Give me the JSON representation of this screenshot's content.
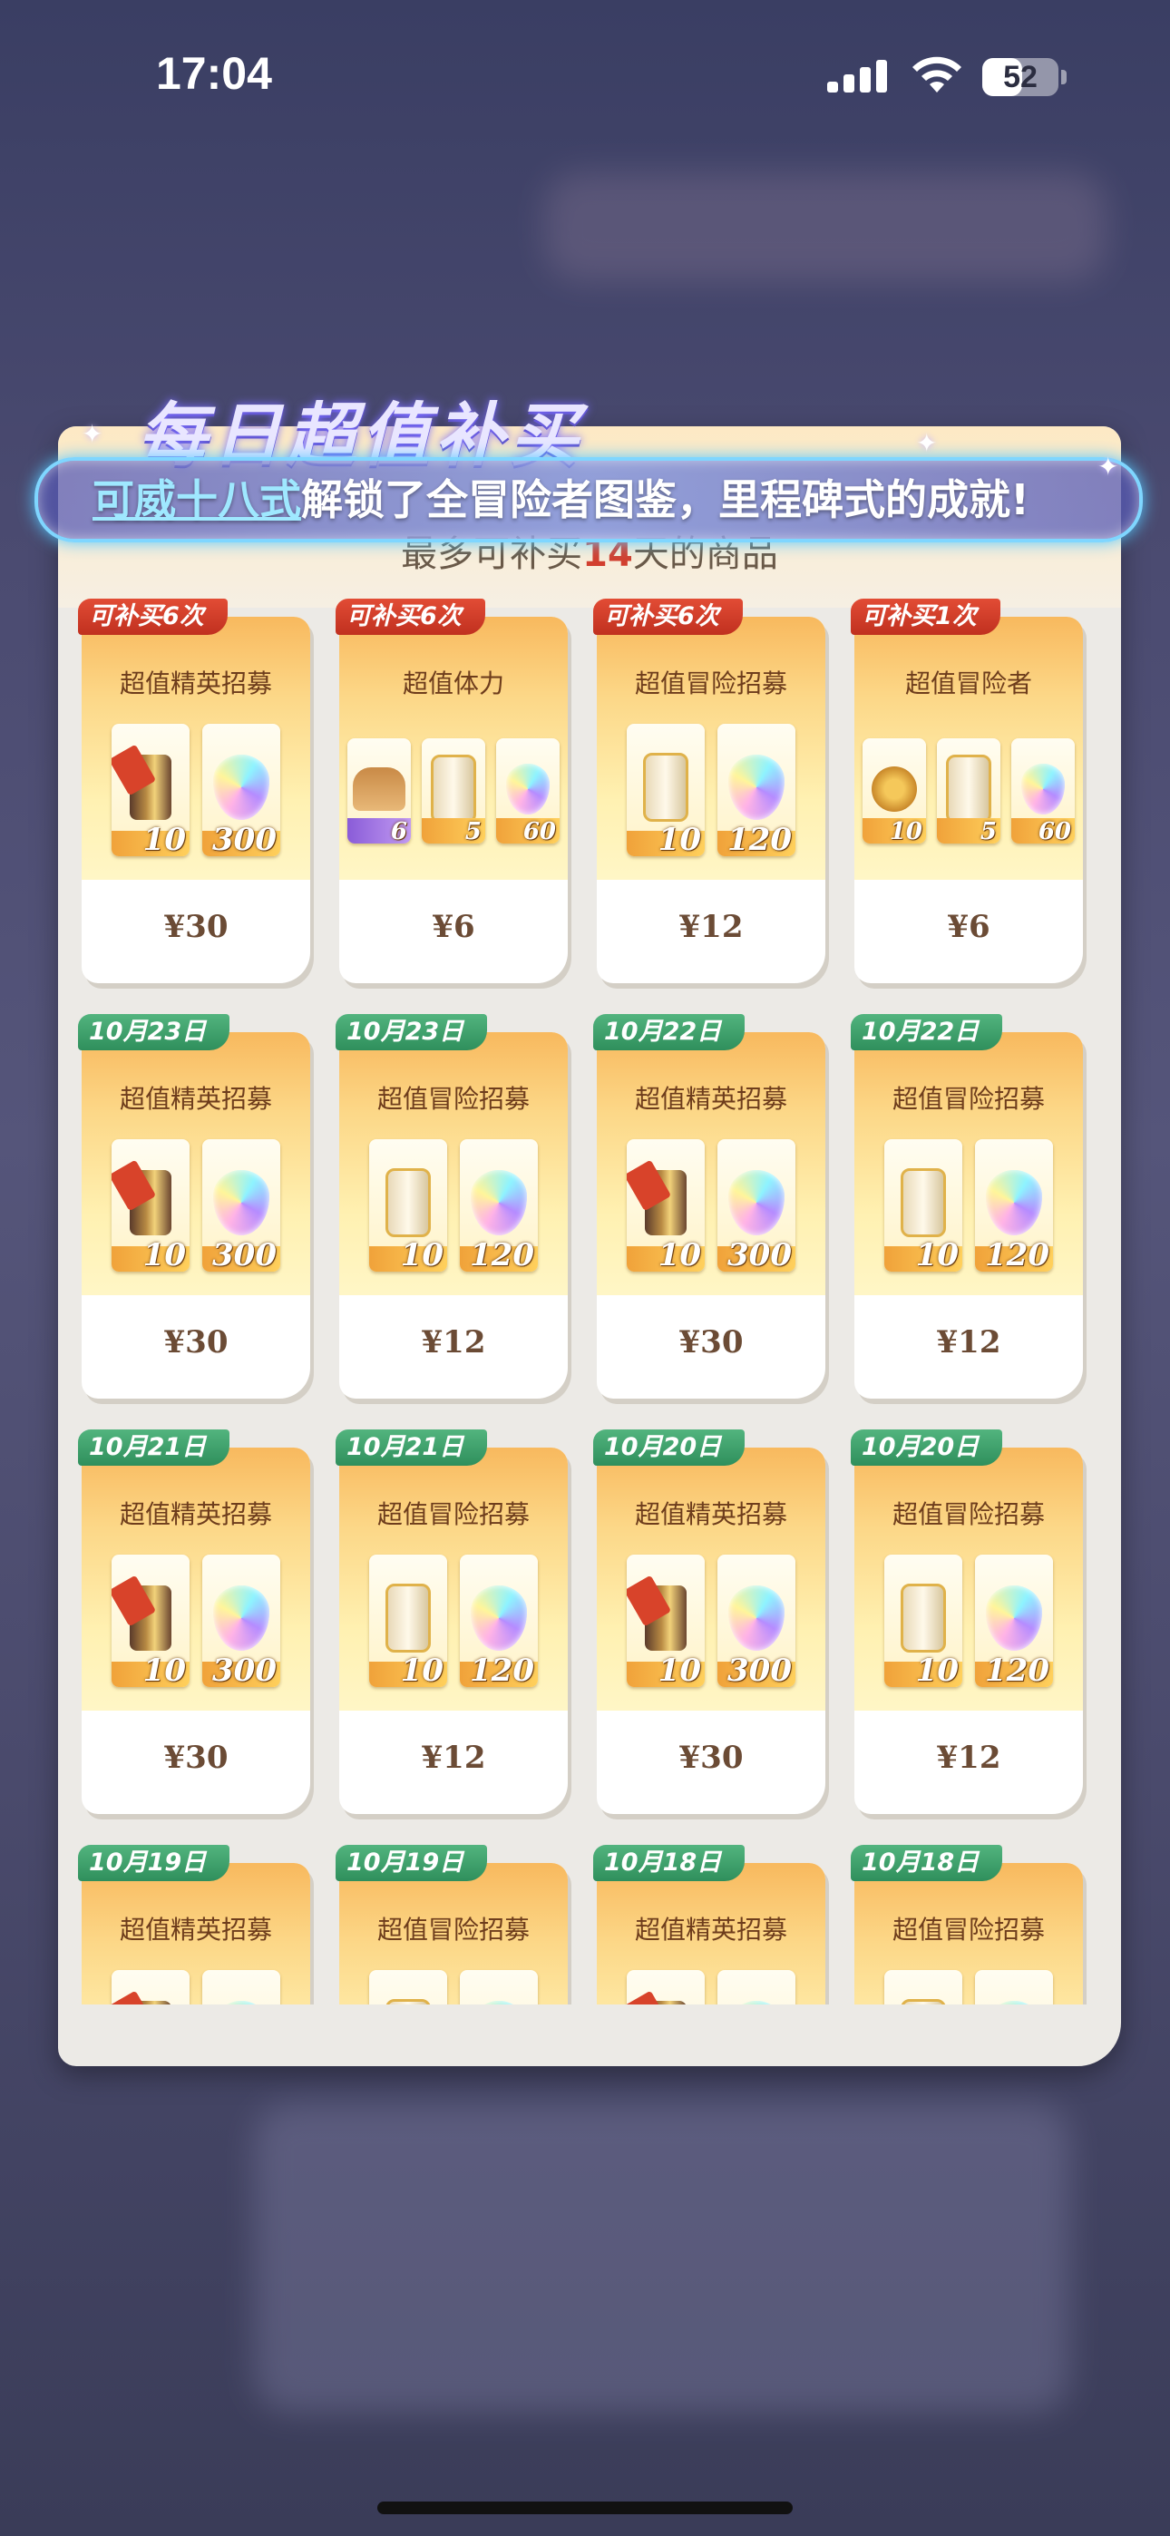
{
  "status_bar": {
    "time": "17:04",
    "battery": "52",
    "battery_level": 0.52
  },
  "header": {
    "title": "每日超值补买",
    "subtitle_prefix": "最多可补买",
    "subtitle_number": "14",
    "subtitle_suffix": "天的商品"
  },
  "notification": {
    "highlight": "可威十八式",
    "message": "解锁了全冒险者图鉴，里程碑式的成就!"
  },
  "cards": [
    {
      "tag": "可补买6次",
      "tag_color": "red",
      "name": "超值精英招募",
      "price": "¥30",
      "items": [
        {
          "icon": "elite-scroll-icon",
          "count": "10"
        },
        {
          "icon": "diamond-gem-icon",
          "count": "300"
        }
      ]
    },
    {
      "tag": "可补买6次",
      "tag_color": "red",
      "name": "超值体力",
      "price": "¥6",
      "items": [
        {
          "icon": "bread-icon",
          "count": "6",
          "foot": "purple"
        },
        {
          "icon": "adventure-scroll-icon",
          "count": "5"
        },
        {
          "icon": "diamond-gem-icon",
          "count": "60"
        }
      ]
    },
    {
      "tag": "可补买6次",
      "tag_color": "red",
      "name": "超值冒险招募",
      "price": "¥12",
      "items": [
        {
          "icon": "adventure-scroll-icon",
          "count": "10"
        },
        {
          "icon": "diamond-gem-icon",
          "count": "120"
        }
      ]
    },
    {
      "tag": "可补买1次",
      "tag_color": "red",
      "name": "超值冒险者",
      "price": "¥6",
      "items": [
        {
          "icon": "adventurer-badge-icon",
          "count": "10"
        },
        {
          "icon": "adventure-scroll-icon",
          "count": "5"
        },
        {
          "icon": "diamond-gem-icon",
          "count": "60"
        }
      ]
    },
    {
      "tag": "10月23日",
      "tag_color": "green",
      "name": "超值精英招募",
      "price": "¥30",
      "items": [
        {
          "icon": "elite-scroll-icon",
          "count": "10"
        },
        {
          "icon": "diamond-gem-icon",
          "count": "300"
        }
      ]
    },
    {
      "tag": "10月23日",
      "tag_color": "green",
      "name": "超值冒险招募",
      "price": "¥12",
      "items": [
        {
          "icon": "adventure-scroll-icon",
          "count": "10"
        },
        {
          "icon": "diamond-gem-icon",
          "count": "120"
        }
      ]
    },
    {
      "tag": "10月22日",
      "tag_color": "green",
      "name": "超值精英招募",
      "price": "¥30",
      "items": [
        {
          "icon": "elite-scroll-icon",
          "count": "10"
        },
        {
          "icon": "diamond-gem-icon",
          "count": "300"
        }
      ]
    },
    {
      "tag": "10月22日",
      "tag_color": "green",
      "name": "超值冒险招募",
      "price": "¥12",
      "items": [
        {
          "icon": "adventure-scroll-icon",
          "count": "10"
        },
        {
          "icon": "diamond-gem-icon",
          "count": "120"
        }
      ]
    },
    {
      "tag": "10月21日",
      "tag_color": "green",
      "name": "超值精英招募",
      "price": "¥30",
      "items": [
        {
          "icon": "elite-scroll-icon",
          "count": "10"
        },
        {
          "icon": "diamond-gem-icon",
          "count": "300"
        }
      ]
    },
    {
      "tag": "10月21日",
      "tag_color": "green",
      "name": "超值冒险招募",
      "price": "¥12",
      "items": [
        {
          "icon": "adventure-scroll-icon",
          "count": "10"
        },
        {
          "icon": "diamond-gem-icon",
          "count": "120"
        }
      ]
    },
    {
      "tag": "10月20日",
      "tag_color": "green",
      "name": "超值精英招募",
      "price": "¥30",
      "items": [
        {
          "icon": "elite-scroll-icon",
          "count": "10"
        },
        {
          "icon": "diamond-gem-icon",
          "count": "300"
        }
      ]
    },
    {
      "tag": "10月20日",
      "tag_color": "green",
      "name": "超值冒险招募",
      "price": "¥12",
      "items": [
        {
          "icon": "adventure-scroll-icon",
          "count": "10"
        },
        {
          "icon": "diamond-gem-icon",
          "count": "120"
        }
      ]
    },
    {
      "tag": "10月19日",
      "tag_color": "green",
      "name": "超值精英招募",
      "price": "",
      "items": [
        {
          "icon": "elite-scroll-icon",
          "count": ""
        },
        {
          "icon": "diamond-gem-icon",
          "count": ""
        }
      ]
    },
    {
      "tag": "10月19日",
      "tag_color": "green",
      "name": "超值冒险招募",
      "price": "",
      "items": [
        {
          "icon": "adventure-scroll-icon",
          "count": ""
        },
        {
          "icon": "diamond-gem-icon",
          "count": ""
        }
      ]
    },
    {
      "tag": "10月18日",
      "tag_color": "green",
      "name": "超值精英招募",
      "price": "",
      "items": [
        {
          "icon": "elite-scroll-icon",
          "count": ""
        },
        {
          "icon": "diamond-gem-icon",
          "count": ""
        }
      ]
    },
    {
      "tag": "10月18日",
      "tag_color": "green",
      "name": "超值冒险招募",
      "price": "",
      "items": [
        {
          "icon": "adventure-scroll-icon",
          "count": ""
        },
        {
          "icon": "diamond-gem-icon",
          "count": ""
        }
      ]
    }
  ]
}
